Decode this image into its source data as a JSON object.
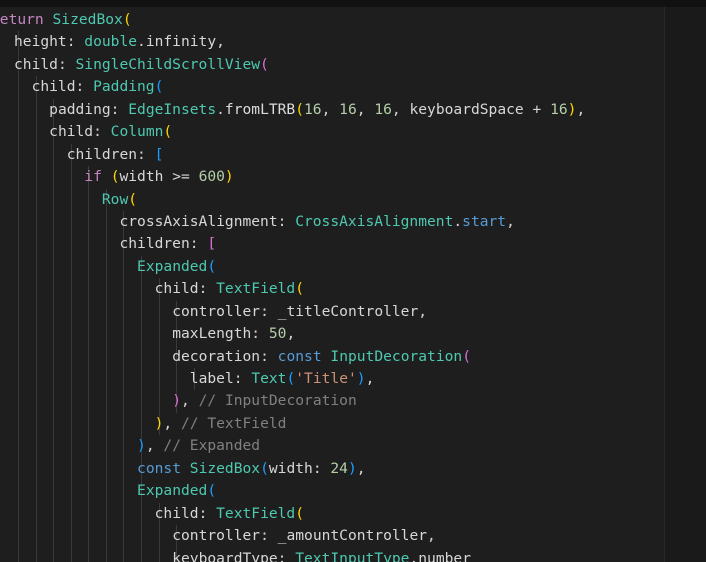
{
  "editor": {
    "language": "dart",
    "colors": {
      "background": "#1e1e1f",
      "keyword": "#c586c0",
      "class": "#4ec9b0",
      "string": "#ce9178",
      "number": "#b5cea8",
      "comment": "#808080",
      "bracket_gold": "#ffd700",
      "bracket_purple": "#da70d6",
      "bracket_blue": "#179fff"
    },
    "lines": [
      {
        "tokens": [
          {
            "t": "return ",
            "c": "kw"
          },
          {
            "t": "SizedBox",
            "c": "cls"
          },
          {
            "t": "(",
            "c": "p1"
          }
        ]
      },
      {
        "tokens": [
          {
            "t": "height",
            "c": "prop"
          },
          {
            "t": ": ",
            "c": "pun"
          },
          {
            "t": "double",
            "c": "cls"
          },
          {
            "t": ".",
            "c": "pun"
          },
          {
            "t": "infinity",
            "c": "prop"
          },
          {
            "t": ",",
            "c": "pun"
          }
        ]
      },
      {
        "tokens": [
          {
            "t": "child",
            "c": "prop"
          },
          {
            "t": ": ",
            "c": "pun"
          },
          {
            "t": "SingleChildScrollView",
            "c": "cls"
          },
          {
            "t": "(",
            "c": "p2"
          }
        ]
      },
      {
        "tokens": [
          {
            "t": "child",
            "c": "prop"
          },
          {
            "t": ": ",
            "c": "pun"
          },
          {
            "t": "Padding",
            "c": "cls"
          },
          {
            "t": "(",
            "c": "p3"
          }
        ]
      },
      {
        "tokens": [
          {
            "t": "padding",
            "c": "prop"
          },
          {
            "t": ": ",
            "c": "pun"
          },
          {
            "t": "EdgeInsets",
            "c": "cls"
          },
          {
            "t": ".",
            "c": "pun"
          },
          {
            "t": "fromLTRB",
            "c": "id"
          },
          {
            "t": "(",
            "c": "p1"
          },
          {
            "t": "16",
            "c": "num"
          },
          {
            "t": ", ",
            "c": "pun"
          },
          {
            "t": "16",
            "c": "num"
          },
          {
            "t": ", ",
            "c": "pun"
          },
          {
            "t": "16",
            "c": "num"
          },
          {
            "t": ", ",
            "c": "pun"
          },
          {
            "t": "keyboardSpace",
            "c": "prop"
          },
          {
            "t": " + ",
            "c": "pun"
          },
          {
            "t": "16",
            "c": "num"
          },
          {
            "t": ")",
            "c": "p1"
          },
          {
            "t": ",",
            "c": "pun"
          }
        ]
      },
      {
        "tokens": [
          {
            "t": "child",
            "c": "prop"
          },
          {
            "t": ": ",
            "c": "pun"
          },
          {
            "t": "Column",
            "c": "cls"
          },
          {
            "t": "(",
            "c": "p1"
          }
        ]
      },
      {
        "tokens": [
          {
            "t": "children",
            "c": "prop"
          },
          {
            "t": ": ",
            "c": "pun"
          },
          {
            "t": "[",
            "c": "p3"
          }
        ]
      },
      {
        "tokens": [
          {
            "t": "if",
            "c": "kw"
          },
          {
            "t": " ",
            "c": "pun"
          },
          {
            "t": "(",
            "c": "p1"
          },
          {
            "t": "width >= ",
            "c": "prop"
          },
          {
            "t": "600",
            "c": "num"
          },
          {
            "t": ")",
            "c": "p1"
          }
        ]
      },
      {
        "tokens": [
          {
            "t": "Row",
            "c": "cls"
          },
          {
            "t": "(",
            "c": "p1"
          }
        ]
      },
      {
        "tokens": [
          {
            "t": "crossAxisAlignment",
            "c": "prop"
          },
          {
            "t": ": ",
            "c": "pun"
          },
          {
            "t": "CrossAxisAlignment",
            "c": "cls"
          },
          {
            "t": ".",
            "c": "pun"
          },
          {
            "t": "start",
            "c": "blue"
          },
          {
            "t": ",",
            "c": "pun"
          }
        ]
      },
      {
        "tokens": [
          {
            "t": "children",
            "c": "prop"
          },
          {
            "t": ": ",
            "c": "pun"
          },
          {
            "t": "[",
            "c": "p2"
          }
        ]
      },
      {
        "tokens": [
          {
            "t": "Expanded",
            "c": "cls"
          },
          {
            "t": "(",
            "c": "p3"
          }
        ]
      },
      {
        "tokens": [
          {
            "t": "child",
            "c": "prop"
          },
          {
            "t": ": ",
            "c": "pun"
          },
          {
            "t": "TextField",
            "c": "cls"
          },
          {
            "t": "(",
            "c": "p1"
          }
        ]
      },
      {
        "tokens": [
          {
            "t": "controller",
            "c": "prop"
          },
          {
            "t": ": ",
            "c": "pun"
          },
          {
            "t": "_titleController",
            "c": "prop"
          },
          {
            "t": ",",
            "c": "pun"
          }
        ]
      },
      {
        "tokens": [
          {
            "t": "maxLength",
            "c": "prop"
          },
          {
            "t": ": ",
            "c": "pun"
          },
          {
            "t": "50",
            "c": "num"
          },
          {
            "t": ",",
            "c": "pun"
          }
        ]
      },
      {
        "tokens": [
          {
            "t": "decoration",
            "c": "prop"
          },
          {
            "t": ": ",
            "c": "pun"
          },
          {
            "t": "const",
            "c": "blue"
          },
          {
            "t": " ",
            "c": "pun"
          },
          {
            "t": "InputDecoration",
            "c": "cls"
          },
          {
            "t": "(",
            "c": "p2"
          }
        ]
      },
      {
        "tokens": [
          {
            "t": "label",
            "c": "prop"
          },
          {
            "t": ": ",
            "c": "pun"
          },
          {
            "t": "Text",
            "c": "cls"
          },
          {
            "t": "(",
            "c": "p3"
          },
          {
            "t": "'Title'",
            "c": "str"
          },
          {
            "t": ")",
            "c": "p3"
          },
          {
            "t": ",",
            "c": "pun"
          }
        ]
      },
      {
        "tokens": [
          {
            "t": ")",
            "c": "p2"
          },
          {
            "t": ", ",
            "c": "pun"
          },
          {
            "t": "// InputDecoration",
            "c": "cm"
          }
        ]
      },
      {
        "tokens": [
          {
            "t": ")",
            "c": "p1"
          },
          {
            "t": ", ",
            "c": "pun"
          },
          {
            "t": "// TextField",
            "c": "cm"
          }
        ]
      },
      {
        "tokens": [
          {
            "t": ")",
            "c": "p3"
          },
          {
            "t": ", ",
            "c": "pun"
          },
          {
            "t": "// Expanded",
            "c": "cm"
          }
        ]
      },
      {
        "tokens": [
          {
            "t": "const",
            "c": "blue"
          },
          {
            "t": " ",
            "c": "pun"
          },
          {
            "t": "SizedBox",
            "c": "cls"
          },
          {
            "t": "(",
            "c": "p3"
          },
          {
            "t": "width",
            "c": "prop"
          },
          {
            "t": ": ",
            "c": "pun"
          },
          {
            "t": "24",
            "c": "num"
          },
          {
            "t": ")",
            "c": "p3"
          },
          {
            "t": ",",
            "c": "pun"
          }
        ]
      },
      {
        "tokens": [
          {
            "t": "Expanded",
            "c": "cls"
          },
          {
            "t": "(",
            "c": "p3"
          }
        ]
      },
      {
        "tokens": [
          {
            "t": "child",
            "c": "prop"
          },
          {
            "t": ": ",
            "c": "pun"
          },
          {
            "t": "TextField",
            "c": "cls"
          },
          {
            "t": "(",
            "c": "p1"
          }
        ]
      },
      {
        "tokens": [
          {
            "t": "controller",
            "c": "prop"
          },
          {
            "t": ": ",
            "c": "pun"
          },
          {
            "t": "_amountController",
            "c": "prop"
          },
          {
            "t": ",",
            "c": "pun"
          }
        ]
      },
      {
        "tokens": [
          {
            "t": "keyboardType",
            "c": "prop"
          },
          {
            "t": ": ",
            "c": "pun"
          },
          {
            "t": "TextInputType",
            "c": "cls"
          },
          {
            "t": ".",
            "c": "pun"
          },
          {
            "t": "number",
            "c": "prop"
          }
        ]
      }
    ]
  }
}
